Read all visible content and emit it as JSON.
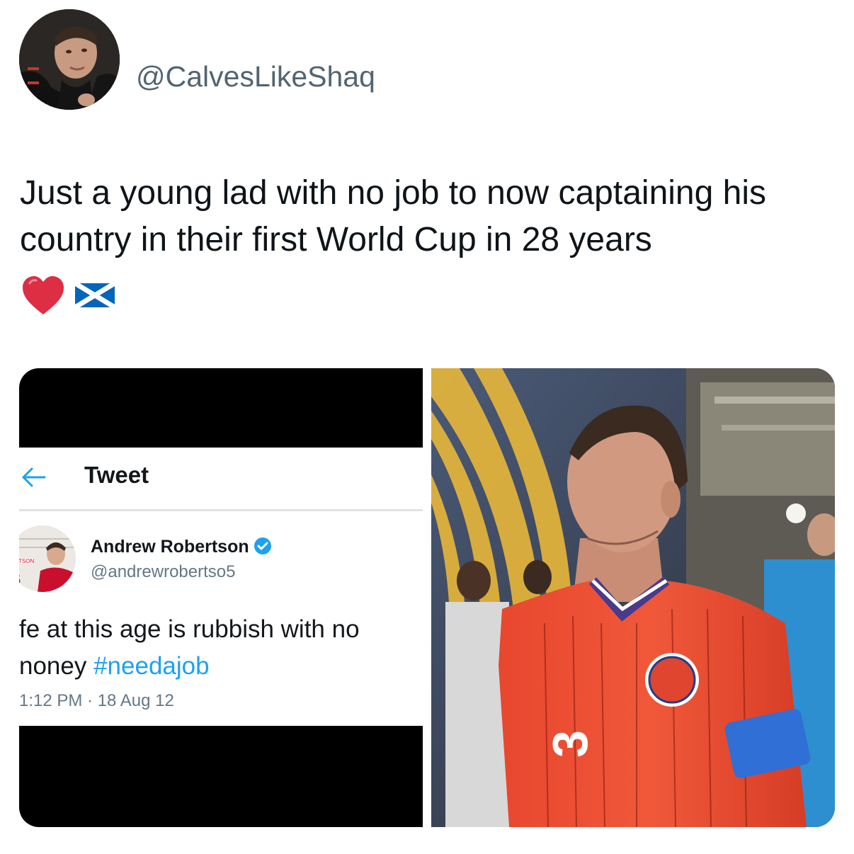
{
  "author": {
    "handle": "@CalvesLikeShaq",
    "avatar_icon": "profile-photo"
  },
  "tweet": {
    "text": "Just a young lad with no job to now captaining his country in their first World Cup in 28 years",
    "emojis": [
      "red-heart",
      "scotland-flag"
    ]
  },
  "embedded_screenshot": {
    "header_title": "Tweet",
    "author_name": "Andrew Robertson",
    "author_handle": "@andrewrobertso5",
    "text_line1": "fe at this age is rubbish with no",
    "text_line2_prefix": "noney ",
    "hashtag": "#needajob",
    "timestamp": "1:12 PM · 18 Aug 12",
    "colors": {
      "hashtag": "#1da1f2",
      "verified": "#1da1f2"
    }
  },
  "photo": {
    "description_icon": "player-in-tunnel-photo",
    "shirt_number": "3"
  }
}
